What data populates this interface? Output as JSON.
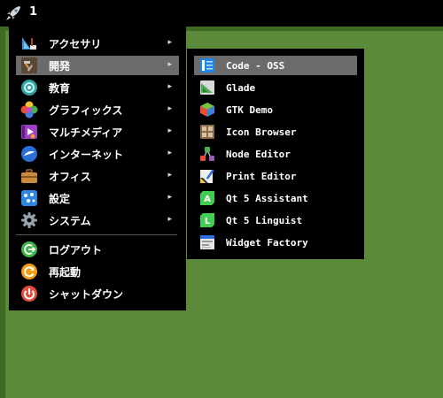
{
  "taskbar": {
    "launcher_icon": "rocket-icon",
    "workspace": "1"
  },
  "menu": {
    "items": [
      {
        "label": "アクセサリ",
        "icon": "accessories-icon",
        "arrow": "▸"
      },
      {
        "label": "開発",
        "icon": "development-icon",
        "arrow": "▸"
      },
      {
        "label": "教育",
        "icon": "education-icon",
        "arrow": "▸"
      },
      {
        "label": "グラフィックス",
        "icon": "graphics-icon",
        "arrow": "▸"
      },
      {
        "label": "マルチメディア",
        "icon": "multimedia-icon",
        "arrow": "▸"
      },
      {
        "label": "インターネット",
        "icon": "internet-icon",
        "arrow": "▸"
      },
      {
        "label": "オフィス",
        "icon": "office-icon",
        "arrow": "▸"
      },
      {
        "label": "設定",
        "icon": "settings-icon",
        "arrow": "▸"
      },
      {
        "label": "システム",
        "icon": "system-gear-icon",
        "arrow": "▸"
      }
    ],
    "actions": [
      {
        "label": "ログアウト",
        "icon": "logout-icon"
      },
      {
        "label": "再起動",
        "icon": "reboot-icon"
      },
      {
        "label": "シャットダウン",
        "icon": "shutdown-icon"
      }
    ]
  },
  "submenu": {
    "items": [
      {
        "label": "Code - OSS",
        "icon": "code-oss-icon"
      },
      {
        "label": "Glade",
        "icon": "glade-icon"
      },
      {
        "label": "GTK Demo",
        "icon": "gtk-demo-icon"
      },
      {
        "label": "Icon Browser",
        "icon": "icon-browser-icon"
      },
      {
        "label": "Node Editor",
        "icon": "node-editor-icon"
      },
      {
        "label": "Print Editor",
        "icon": "print-editor-icon"
      },
      {
        "label": "Qt 5 Assistant",
        "icon": "qt-assistant-icon"
      },
      {
        "label": "Qt 5 Linguist",
        "icon": "qt-linguist-icon"
      },
      {
        "label": "Widget Factory",
        "icon": "widget-factory-icon"
      }
    ]
  },
  "colors": {
    "desktop": "#5a8a3a",
    "menu_bg": "#000000",
    "selection": "#6b6b6b"
  }
}
